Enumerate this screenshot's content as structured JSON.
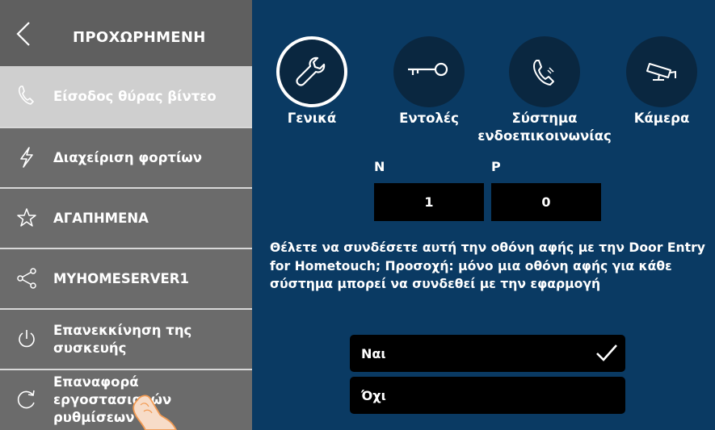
{
  "sidebar": {
    "title": "ΠΡΟΧΩΡΗΜΕΝΗ",
    "items": [
      {
        "label": "Είσοδος θύρας βίντεο",
        "icon": "phone-icon",
        "active": true
      },
      {
        "label": "Διαχείριση φορτίων",
        "icon": "lightning-icon"
      },
      {
        "label": "ΑΓΑΠΗΜΕΝΑ",
        "icon": "star-icon"
      },
      {
        "label": "MYHOMESERVER1",
        "icon": "share-icon"
      },
      {
        "label": "Επανεκκίνηση της συσκευής",
        "icon": "power-icon"
      },
      {
        "label": "Επαναφορά εργοστασιακών ρυθμίσεων",
        "icon": "reset-icon"
      }
    ]
  },
  "categories": [
    {
      "label": "Γενικά",
      "icon": "wrench-icon",
      "selected": true
    },
    {
      "label": "Εντολές",
      "icon": "key-icon"
    },
    {
      "label": "Σύστημα ενδοεπικοινωνίας",
      "icon": "phone-icon"
    },
    {
      "label": "Κάμερα",
      "icon": "camera-icon"
    }
  ],
  "address": {
    "n_label": "N",
    "p_label": "P",
    "n_value": "1",
    "p_value": "0"
  },
  "question": "Θέλετε να συνδέσετε αυτή την οθόνη αφής με την Door Entry for Hometouch; Προσοχή: μόνο μια οθόνη αφής για κάθε σύστημα μπορεί να συνδεθεί με την εφαρμογή",
  "options": [
    {
      "label": "Ναι",
      "checked": true
    },
    {
      "label": "Όχι",
      "checked": false
    }
  ],
  "colors": {
    "sidebar_bg": "#6b6b6b",
    "sidebar_active": "#cfcfcf",
    "main_bg": "#0a3a63",
    "circle_bg": "#0a2740"
  }
}
